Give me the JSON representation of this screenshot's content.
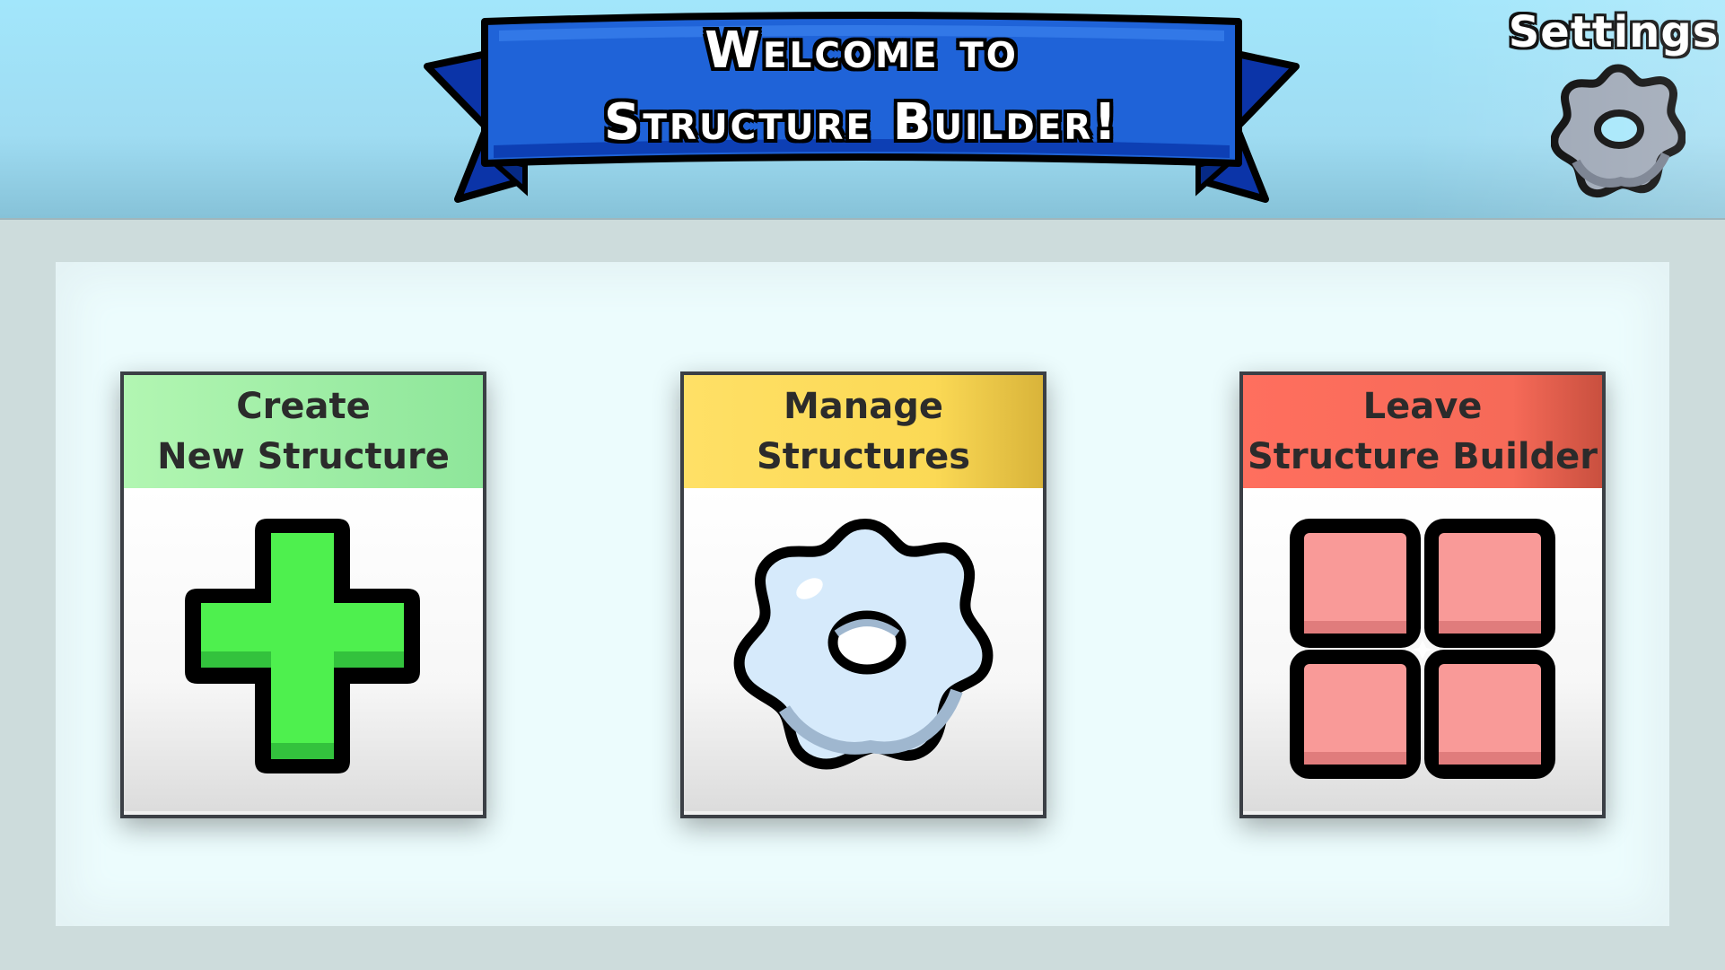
{
  "header": {
    "title_line1": "Welcome to",
    "title_line2": "Structure Builder!",
    "banner_color": "#1f63d8"
  },
  "settings": {
    "label": "Settings",
    "icon": "gear-icon"
  },
  "menu": {
    "cards": [
      {
        "title_line1": "Create",
        "title_line2": "New Structure",
        "header_color": "#a6f2a8",
        "icon": "plus-icon",
        "icon_color": "#4ef04e"
      },
      {
        "title_line1": "Manage",
        "title_line2": "Structures",
        "header_color": "#fddc5c",
        "icon": "gear-icon",
        "icon_color": "#d6eafb"
      },
      {
        "title_line1": "Leave",
        "title_line2": "Structure Builder",
        "header_color": "#fb6d5c",
        "icon": "grid-icon",
        "icon_color": "#f99a98"
      }
    ]
  }
}
